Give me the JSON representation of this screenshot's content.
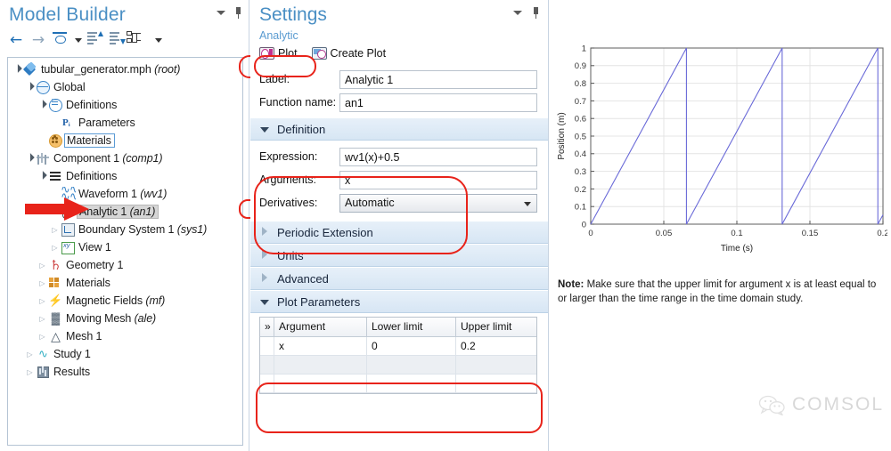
{
  "model_builder": {
    "title": "Model Builder",
    "toolbar": {
      "back": "←",
      "forward": "→",
      "show_icon": "eye-icon",
      "collapse_icon": "collapse-all-icon",
      "expand_icon": "expand-all-icon",
      "tree_icon": "tree-node-icon"
    },
    "tree": [
      {
        "label": "tubular_generator.mph",
        "suffix": "(root)",
        "depth": 0,
        "expander": "open",
        "icon": "mph-file-icon",
        "state": "normal"
      },
      {
        "label": "Global",
        "suffix": "",
        "depth": 1,
        "expander": "open",
        "icon": "globe-icon",
        "state": "normal"
      },
      {
        "label": "Definitions",
        "suffix": "",
        "depth": 2,
        "expander": "open",
        "icon": "definitions-icon",
        "state": "normal"
      },
      {
        "label": "Parameters",
        "suffix": "",
        "depth": 3,
        "expander": "none",
        "icon": "parameters-icon",
        "state": "normal"
      },
      {
        "label": "Materials",
        "suffix": "",
        "depth": 2,
        "expander": "none",
        "icon": "materials-global-icon",
        "state": "outlined"
      },
      {
        "label": "Component 1",
        "suffix": "(comp1)",
        "depth": 1,
        "expander": "open",
        "icon": "component-icon",
        "state": "normal"
      },
      {
        "label": "Definitions",
        "suffix": "",
        "depth": 2,
        "expander": "open",
        "icon": "definitions-comp-icon",
        "state": "normal"
      },
      {
        "label": "Waveform 1",
        "suffix": "(wv1)",
        "depth": 3,
        "expander": "none",
        "icon": "waveform-icon",
        "state": "normal"
      },
      {
        "label": "Analytic 1",
        "suffix": "(an1)",
        "depth": 3,
        "expander": "none",
        "icon": "analytic-function-icon",
        "state": "selected"
      },
      {
        "label": "Boundary System 1",
        "suffix": "(sys1)",
        "depth": 3,
        "expander": "closed",
        "icon": "boundary-system-icon",
        "state": "normal"
      },
      {
        "label": "View 1",
        "suffix": "",
        "depth": 3,
        "expander": "closed",
        "icon": "view-icon",
        "state": "normal"
      },
      {
        "label": "Geometry 1",
        "suffix": "",
        "depth": 2,
        "expander": "closed",
        "icon": "geometry-icon",
        "state": "normal"
      },
      {
        "label": "Materials",
        "suffix": "",
        "depth": 2,
        "expander": "closed",
        "icon": "materials-icon",
        "state": "normal"
      },
      {
        "label": "Magnetic Fields",
        "suffix": "(mf)",
        "depth": 2,
        "expander": "closed",
        "icon": "magnetic-fields-icon",
        "state": "normal"
      },
      {
        "label": "Moving Mesh",
        "suffix": "(ale)",
        "depth": 2,
        "expander": "closed",
        "icon": "moving-mesh-icon",
        "state": "normal"
      },
      {
        "label": "Mesh 1",
        "suffix": "",
        "depth": 2,
        "expander": "closed",
        "icon": "mesh-icon",
        "state": "normal"
      },
      {
        "label": "Study 1",
        "suffix": "",
        "depth": 1,
        "expander": "closed",
        "icon": "study-icon",
        "state": "normal"
      },
      {
        "label": "Results",
        "suffix": "",
        "depth": 1,
        "expander": "closed",
        "icon": "results-icon",
        "state": "normal"
      }
    ]
  },
  "settings": {
    "title": "Settings",
    "subtitle": "Analytic",
    "toolbar": {
      "plot_label": "Plot",
      "create_plot_label": "Create Plot"
    },
    "label_field": {
      "label": "Label:",
      "value": "Analytic 1"
    },
    "function_name_field": {
      "label": "Function name:",
      "value": "an1"
    },
    "sections": [
      {
        "title": "Definition",
        "state": "open"
      },
      {
        "title": "Periodic Extension",
        "state": "closed"
      },
      {
        "title": "Units",
        "state": "closed"
      },
      {
        "title": "Advanced",
        "state": "closed"
      },
      {
        "title": "Plot Parameters",
        "state": "open"
      }
    ],
    "definition": {
      "expression": {
        "label": "Expression:",
        "value": "wv1(x)+0.5"
      },
      "arguments": {
        "label": "Arguments:",
        "value": "x"
      },
      "derivatives": {
        "label": "Derivatives:",
        "value": "Automatic"
      }
    },
    "plot_parameters": {
      "columns": [
        "",
        "Argument",
        "Lower limit",
        "Upper limit"
      ],
      "rows": [
        {
          "argument": "x",
          "lower": "0",
          "upper": "0.2"
        }
      ]
    }
  },
  "chart_data": {
    "type": "line",
    "title": "",
    "xlabel": "Time (s)",
    "ylabel": "Position (m)",
    "xlim": [
      0,
      0.2
    ],
    "ylim": [
      0,
      1
    ],
    "xticks": [
      "0",
      "0.05",
      "0.1",
      "0.15",
      "0.2"
    ],
    "xtick_values": [
      0,
      0.05,
      0.1,
      0.15,
      0.2
    ],
    "yticks": [
      "0",
      "0.1",
      "0.2",
      "0.3",
      "0.4",
      "0.5",
      "0.6",
      "0.7",
      "0.8",
      "0.9",
      "1"
    ],
    "ytick_values": [
      0,
      0.1,
      0.2,
      0.3,
      0.4,
      0.5,
      0.6,
      0.7,
      0.8,
      0.9,
      1
    ],
    "grid": true,
    "legend": "none",
    "line_color": "#6a6ad8",
    "series": [
      {
        "name": "Position",
        "waveform": "sawtooth",
        "period": 0.0655,
        "amplitude_min": 0,
        "amplitude_max": 1,
        "points": [
          [
            0,
            0
          ],
          [
            0.0655,
            1
          ],
          [
            0.0655,
            0
          ],
          [
            0.131,
            1
          ],
          [
            0.131,
            0
          ],
          [
            0.1965,
            1
          ],
          [
            0.1965,
            0
          ],
          [
            0.2,
            0.053
          ]
        ]
      }
    ]
  },
  "note": {
    "prefix": "Note:",
    "text": " Make sure that the upper limit for argument x is at least equal to or larger than the time range in the time domain study."
  },
  "watermark": {
    "icon": "wechat-icon",
    "text": "COMSOL"
  },
  "colors": {
    "accent_blue": "#4a8fc4",
    "highlight_red": "#e8231a",
    "arrow_red": "#e8231a",
    "plot_line": "#6a6ad8",
    "section_header": "#dce9f5"
  }
}
